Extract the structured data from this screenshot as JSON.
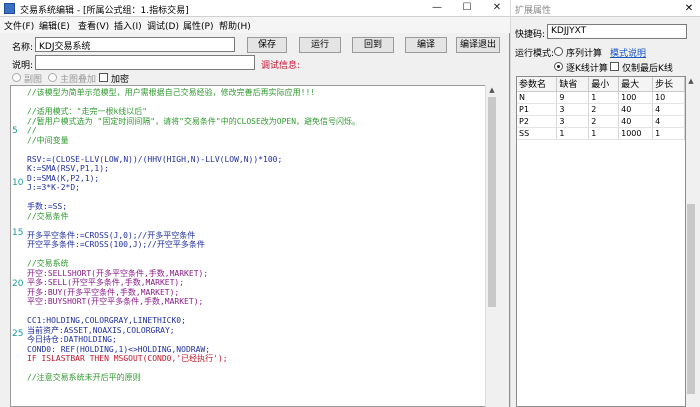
{
  "window": {
    "title": "交易系统编辑 - [所属公式组：1.指标交易]",
    "min": "—",
    "max": "☐",
    "close": "✕"
  },
  "menu": [
    "文件(F)",
    "编辑(E)",
    "查看(V)",
    "插入(I)",
    "调试(D)",
    "属性(P)",
    "帮助(H)"
  ],
  "form": {
    "name_label": "名称:",
    "name_value": "KDJ交易系统",
    "desc_label": "说明:",
    "desc_value": "",
    "debug_label": "调试信息:",
    "opt_fuquan": "副图",
    "opt_zhutu": "主图叠加",
    "opt_encrypt": "加密"
  },
  "toolbar": {
    "save": "保存",
    "run": "运行",
    "revert": "回到",
    "compile": "编译",
    "compile_exit": "编译退出"
  },
  "editor": {
    "gutter": [
      "5",
      "10",
      "15",
      "20",
      "25"
    ],
    "lines": [
      {
        "t": "//该模型为简单示范模型，用户需根据自己交易经验，修改完善后再实际应用!!!",
        "c": "c-comment"
      },
      {
        "t": "",
        "c": ""
      },
      {
        "t": "//适用模式：\"走完一根k线以后\"",
        "c": "c-comment"
      },
      {
        "t": "//暂用户模式选为 \"固定时间间隔\"，请将\"交易条件\"中的CLOSE改为OPEN，避免信号闪烁。",
        "c": "c-comment"
      },
      {
        "t": "//",
        "c": "c-comment"
      },
      {
        "t": "//中间变量",
        "c": "c-comment"
      },
      {
        "t": "",
        "c": ""
      },
      {
        "t": "RSV:=(CLOSE-LLV(LOW,N))/(HHV(HIGH,N)-LLV(LOW,N))*100;",
        "c": "c-blue"
      },
      {
        "t": "K:=SMA(RSV,P1,1);",
        "c": "c-blue"
      },
      {
        "t": "D:=SMA(K,P2,1);",
        "c": "c-blue"
      },
      {
        "t": "J:=3*K-2*D;",
        "c": "c-blue"
      },
      {
        "t": "",
        "c": ""
      },
      {
        "t": "手数:=SS;",
        "c": "c-blue"
      },
      {
        "t": "//交易条件",
        "c": "c-comment"
      },
      {
        "t": "",
        "c": ""
      },
      {
        "t": "开多平空条件:=CROSS(J,0);//开多平空条件",
        "c": "c-blue"
      },
      {
        "t": "开空平多条件:=CROSS(100,J);//开空平多条件",
        "c": "c-blue"
      },
      {
        "t": "",
        "c": ""
      },
      {
        "t": "//交易系统",
        "c": "c-comment"
      },
      {
        "t": "开空:SELLSHORT(开多平空条件,手数,MARKET);",
        "c": "c-fn"
      },
      {
        "t": "平多:SELL(开空平多条件,手数,MARKET);",
        "c": "c-fn"
      },
      {
        "t": "开多:BUY(开多平空条件,手数,MARKET);",
        "c": "c-fn"
      },
      {
        "t": "平空:BUYSHORT(开空平多条件,手数,MARKET);",
        "c": "c-fn"
      },
      {
        "t": "",
        "c": ""
      },
      {
        "t": "CC1:HOLDING,COLORGRAY,LINETHICK0;",
        "c": "c-blue"
      },
      {
        "t": "当前资产:ASSET,NOAXIS,COLORGRAY;",
        "c": "c-blue"
      },
      {
        "t": "今日持仓:DATHOLDING;",
        "c": "c-blue"
      },
      {
        "t": "COND0: REF(HOLDING,1)<>HOLDING,NODRAW;",
        "c": "c-blue"
      },
      {
        "t": "IF ISLASTBAR THEN MSGOUT(COND0,'已经执行');",
        "c": "c-red"
      },
      {
        "t": "",
        "c": ""
      },
      {
        "t": "//注意交易系统未开后平的原则",
        "c": "c-comment"
      }
    ]
  },
  "props": {
    "title": "扩展属性",
    "shortcut_label": "快捷码:",
    "shortcut_value": "KDJJYXT",
    "mode_label": "运行模式:",
    "mode_seq": "序列计算",
    "mode_help": "模式说明",
    "mode_kline": "逐K线计算",
    "mode_only_close": "仅制最后K线",
    "table_headers": [
      "参数名",
      "缺省",
      "最小",
      "最大",
      "步长"
    ],
    "table_rows": [
      [
        "N",
        "9",
        "1",
        "100",
        "10"
      ],
      [
        "P1",
        "3",
        "2",
        "40",
        "4"
      ],
      [
        "P2",
        "3",
        "2",
        "40",
        "4"
      ],
      [
        "SS",
        "1",
        "1",
        "1000",
        "1"
      ]
    ]
  }
}
